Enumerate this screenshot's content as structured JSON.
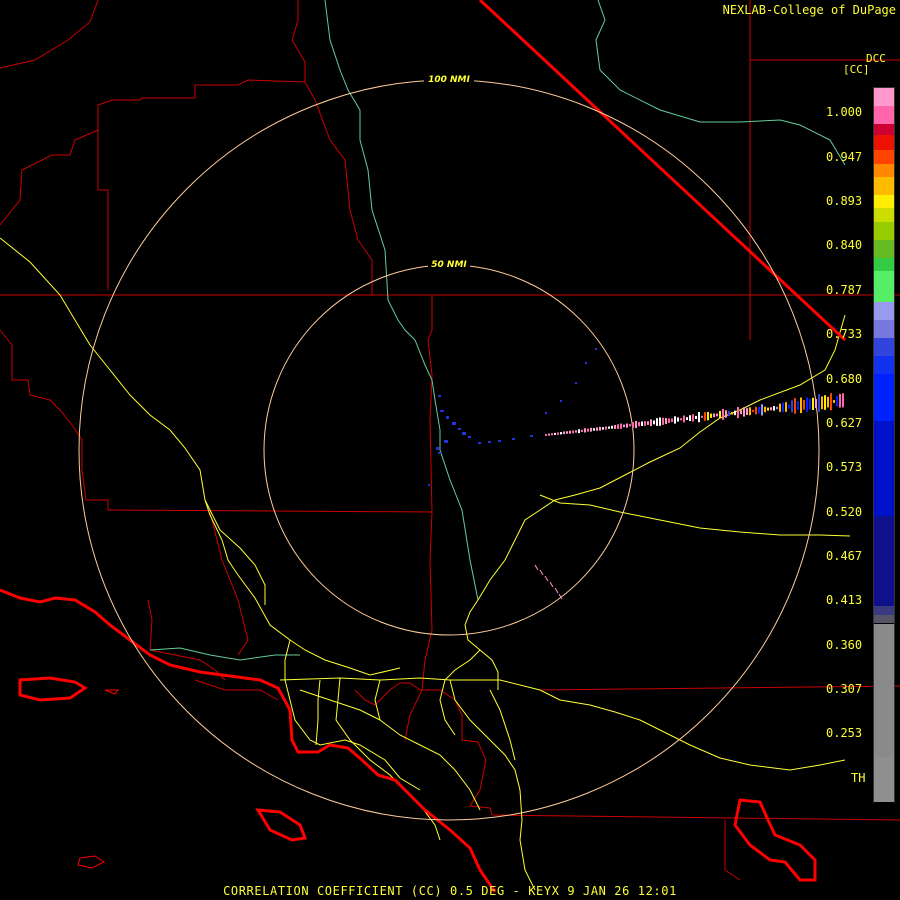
{
  "credit": "NEXLAB-College of DuPage",
  "site": "DCC",
  "unit": "[CC]",
  "range_rings": [
    "100 NMI",
    "50 NMI"
  ],
  "scale_labels": [
    "1.000",
    "0.947",
    "0.893",
    "0.840",
    "0.787",
    "0.733",
    "0.680",
    "0.627",
    "0.573",
    "0.520",
    "0.467",
    "0.413",
    "0.360",
    "0.307",
    "0.253",
    "TH"
  ],
  "product_footer": "CORRELATION COEFFICIENT (CC) 0.5 DEG - KEYX 9 JAN 26 12:01",
  "colors": {
    "coastline": "#ff0000",
    "borders": "#cc0000",
    "highways": "#ffff33",
    "rivers": "#66cc99",
    "rings": "#ffcc99",
    "label_text": "#ffff33"
  },
  "colorbar": [
    {
      "color": "#ff99cc",
      "value": 1.0
    },
    {
      "color": "#ff66aa",
      "value": 0.98
    },
    {
      "color": "#cc0033",
      "value": 0.96
    },
    {
      "color": "#ee1100",
      "value": 0.947
    },
    {
      "color": "#ff4400",
      "value": 0.93
    },
    {
      "color": "#ff8800",
      "value": 0.915
    },
    {
      "color": "#ffbb00",
      "value": 0.9
    },
    {
      "color": "#ffee00",
      "value": 0.88
    },
    {
      "color": "#ccdd00",
      "value": 0.865
    },
    {
      "color": "#99cc00",
      "value": 0.85
    },
    {
      "color": "#66bb22",
      "value": 0.83
    },
    {
      "color": "#33cc44",
      "value": 0.81
    },
    {
      "color": "#55ee66",
      "value": 0.795
    },
    {
      "color": "#9999ee",
      "value": 0.76
    },
    {
      "color": "#7777dd",
      "value": 0.74
    },
    {
      "color": "#3344dd",
      "value": 0.72
    },
    {
      "color": "#1133ee",
      "value": 0.7
    },
    {
      "color": "#0022ff",
      "value": 0.68
    },
    {
      "color": "#0011cc",
      "value": 0.627
    },
    {
      "color": "#10108a",
      "value": 0.52
    },
    {
      "color": "#3a3a80",
      "value": 0.42
    },
    {
      "color": "#555566",
      "value": 0.41
    },
    {
      "color": "#8a8a8a",
      "value": 0.4
    },
    {
      "color": "#8f8f8f",
      "value": 0.25
    },
    {
      "color": "#000000",
      "value": 0.2
    }
  ]
}
